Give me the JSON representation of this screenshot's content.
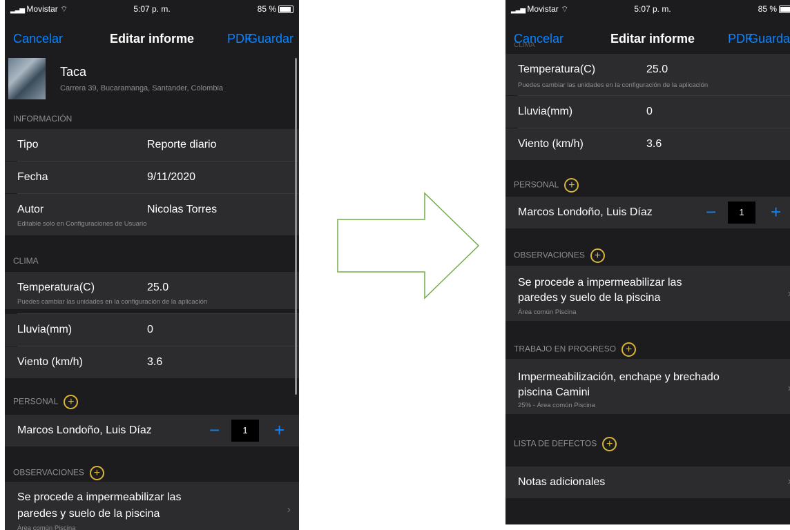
{
  "status": {
    "carrier": "Movistar",
    "time": "5:07 p. m.",
    "battery": "85 %"
  },
  "nav": {
    "cancel": "Cancelar",
    "title": "Editar informe",
    "pdf": "PDF",
    "save": "Guardar"
  },
  "project": {
    "name": "Taca",
    "address": "Carrera 39, Bucaramanga, Santander, Colombia"
  },
  "sections": {
    "info": "INFORMACIÓN",
    "clima": "CLIMA",
    "personal": "PERSONAL",
    "observaciones": "OBSERVACIONES",
    "trabajo": "TRABAJO EN PROGRESO",
    "defectos": "LISTA DE DEFECTOS",
    "clima_partial": "CLIMA"
  },
  "info": {
    "tipo_label": "Tipo",
    "tipo_value": "Reporte diario",
    "fecha_label": "Fecha",
    "fecha_value": "9/11/2020",
    "autor_label": "Autor",
    "autor_value": "Nicolas  Torres",
    "autor_note": "Editable solo en Configuraciones de Usuario"
  },
  "clima": {
    "temp_label": "Temperatura(C)",
    "temp_value": "25.0",
    "temp_note": "Puedes cambiar las unidades en la configuración de la aplicación",
    "lluvia_label": "Lluvia(mm)",
    "lluvia_value": "0",
    "viento_label": "Viento (km/h)",
    "viento_value": "3.6"
  },
  "personal": {
    "names": "Marcos Londoño,  Luis Díaz",
    "count": "1",
    "minus": "−",
    "plus": "+",
    "add": "+"
  },
  "observacion": {
    "line1": "Se procede a impermeabilizar las",
    "line2": "paredes y suelo de la piscina",
    "note": "Área común Piscina",
    "add": "+",
    "chevron": "›"
  },
  "trabajo": {
    "line1": "Impermeabilización, enchape y brechado",
    "line2": "piscina Camini",
    "note": "25% - Área común Piscina",
    "add": "+",
    "chevron": "›"
  },
  "defectos": {
    "add": "+"
  },
  "notas": {
    "label": "Notas adicionales",
    "chevron": "›"
  },
  "colors": {
    "accent": "#0a84ff",
    "add_button": "#d9b535",
    "arrow": "#70ad47",
    "background": "#1c1c1e",
    "cell": "#2c2c2e"
  }
}
